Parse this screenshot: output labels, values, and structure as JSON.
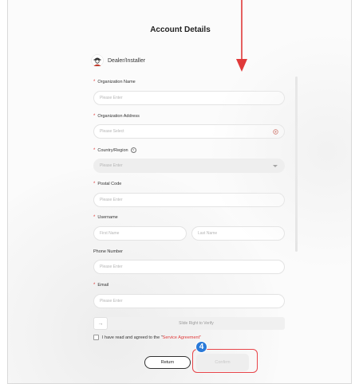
{
  "page": {
    "title": "Account Details",
    "role_label": "Dealer/Installer"
  },
  "fields": {
    "organization_name": {
      "label": "Organization Name",
      "placeholder": "Please Enter",
      "required": "*"
    },
    "organization_address": {
      "label": "Organization Address",
      "placeholder": "Please Select",
      "required": "*"
    },
    "country_region": {
      "label": "Country/Region",
      "placeholder": "Please Enter",
      "required": "*",
      "help": "?"
    },
    "postal_code": {
      "label": "Postal Code",
      "placeholder": "Please Enter",
      "required": "*"
    },
    "username": {
      "label": "Username",
      "first_placeholder": "First Name",
      "last_placeholder": "Last Name",
      "required": "*"
    },
    "phone_number": {
      "label": "Phone Number",
      "placeholder": "Please Enter"
    },
    "email": {
      "label": "Email",
      "placeholder": "Please Enter",
      "required": "*"
    }
  },
  "verify": {
    "handle": "→",
    "text": "Slide Right to Verify"
  },
  "agreement": {
    "prefix": "I have read and agreed to the \"",
    "link": "Service Agreement",
    "suffix": "\""
  },
  "buttons": {
    "return_label": "Return",
    "confirm_label": "Confirm"
  },
  "annotation": {
    "step_number": "4",
    "highlight_color": "#e8454a",
    "badge_color": "#2979d8",
    "arrow_color": "#e03a3a"
  }
}
